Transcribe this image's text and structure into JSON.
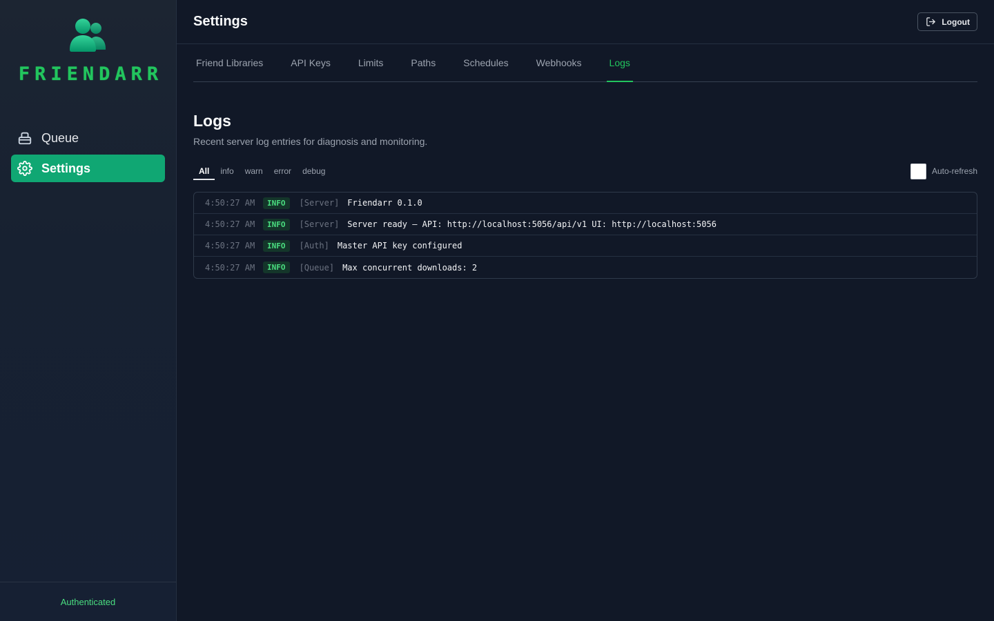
{
  "app": {
    "name": "FRIENDARR"
  },
  "sidebar": {
    "items": [
      {
        "label": "Queue",
        "icon": "box-icon",
        "active": false
      },
      {
        "label": "Settings",
        "icon": "gear-icon",
        "active": true
      }
    ],
    "footer": "Authenticated"
  },
  "header": {
    "title": "Settings",
    "logout_label": "Logout"
  },
  "tabs": [
    {
      "label": "Friend Libraries"
    },
    {
      "label": "API Keys"
    },
    {
      "label": "Limits"
    },
    {
      "label": "Paths"
    },
    {
      "label": "Schedules"
    },
    {
      "label": "Webhooks"
    },
    {
      "label": "Logs",
      "active": true
    }
  ],
  "logs": {
    "title": "Logs",
    "description": "Recent server log entries for diagnosis and monitoring.",
    "filters": [
      "All",
      "info",
      "warn",
      "error",
      "debug"
    ],
    "active_filter": "All",
    "auto_refresh_label": "Auto-refresh",
    "auto_refresh_checked": false,
    "entries": [
      {
        "time": "4:50:27 AM",
        "level": "INFO",
        "source": "[Server]",
        "message": "Friendarr 0.1.0"
      },
      {
        "time": "4:50:27 AM",
        "level": "INFO",
        "source": "[Server]",
        "message": "Server ready — API: http://localhost:5056/api/v1 UI: http://localhost:5056"
      },
      {
        "time": "4:50:27 AM",
        "level": "INFO",
        "source": "[Auth]",
        "message": "Master API key configured"
      },
      {
        "time": "4:50:27 AM",
        "level": "INFO",
        "source": "[Queue]",
        "message": "Max concurrent downloads: 2"
      }
    ]
  },
  "colors": {
    "accent": "#22c55e",
    "active_nav": "#10a773",
    "background": "#111827"
  }
}
